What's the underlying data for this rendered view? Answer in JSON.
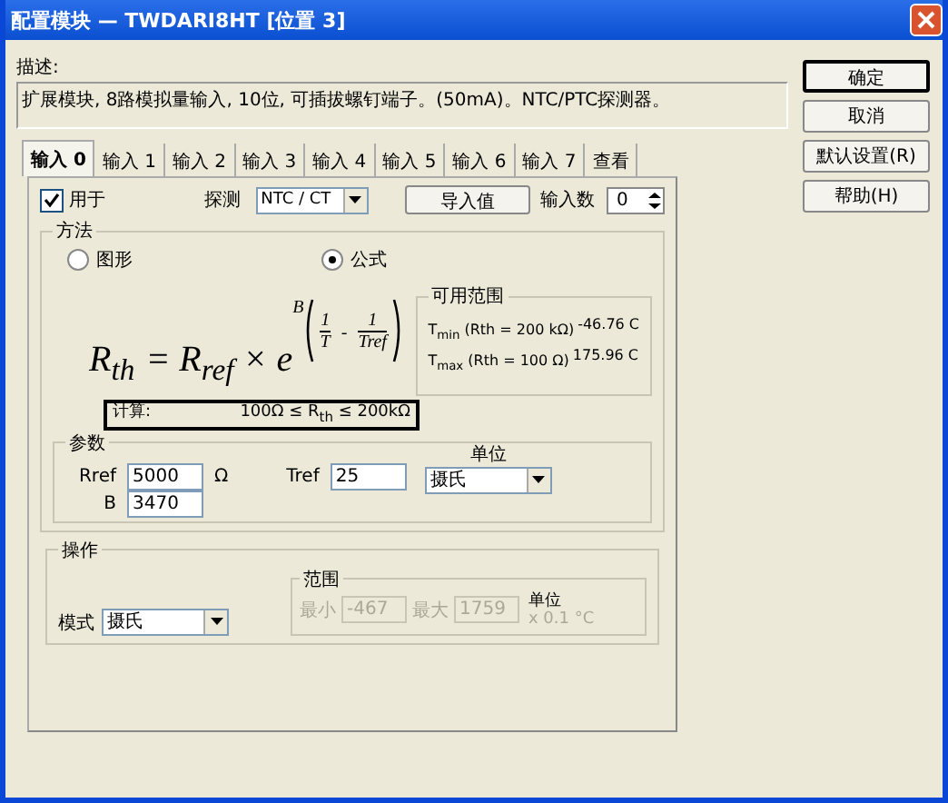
{
  "window": {
    "title": "配置模块 — TWDARI8HT [位置 3]"
  },
  "description": {
    "label": "描述:",
    "text": "扩展模块, 8路模拟量输入, 10位, 可插拔螺钉端子。(50mA)。NTC/PTC探测器。"
  },
  "buttons": [
    {
      "label": "确定",
      "default": true
    },
    {
      "label": "取消",
      "default": false
    },
    {
      "label": "默认设置(R)",
      "default": false
    },
    {
      "label": "帮助(H)",
      "default": false
    }
  ],
  "tabs": [
    {
      "label": "输入 0",
      "selected": true
    },
    {
      "label": "输入 1",
      "selected": false
    },
    {
      "label": "输入 2",
      "selected": false
    },
    {
      "label": "输入 3",
      "selected": false
    },
    {
      "label": "输入 4",
      "selected": false
    },
    {
      "label": "输入 5",
      "selected": false
    },
    {
      "label": "输入 6",
      "selected": false
    },
    {
      "label": "输入 7",
      "selected": false
    },
    {
      "label": "查看",
      "selected": false
    }
  ],
  "used": {
    "label": "用于",
    "checked": true
  },
  "probe": {
    "label": "探测",
    "value": "NTC / CT"
  },
  "import_button": "导入值",
  "input_count": {
    "label": "输入数",
    "value": "0"
  },
  "method": {
    "title": "方法",
    "options": [
      {
        "label": "图形",
        "selected": false
      },
      {
        "label": "公式",
        "selected": true
      }
    ]
  },
  "formula": {
    "lhs": "R$_{th}$",
    "rhs": "= R$_{ref}$ × e",
    "coef": "B",
    "num1": "1",
    "den1": "T",
    "op": "-",
    "num2": "1",
    "den2": "Tref"
  },
  "range_info": {
    "title": "可用范围",
    "rows": [
      {
        "label": "T$_{min}$ (Rth = 200 kΩ)",
        "value": "-46.76 C"
      },
      {
        "label": "T$_{max}$ (Rth = 100 Ω)",
        "value": "175.96 C"
      }
    ]
  },
  "calc": {
    "label": "计算:",
    "text": "100Ω ≤ R$_{th}$ ≤ 200kΩ"
  },
  "params": {
    "title": "参数",
    "rref": {
      "label": "Rref",
      "value": "5000",
      "unit": "Ω"
    },
    "b": {
      "label": "B",
      "value": "3470"
    },
    "tref": {
      "label": "Tref",
      "value": "25"
    },
    "unit": {
      "label": "单位",
      "value": "摄氏"
    }
  },
  "operation": {
    "title": "操作",
    "mode": {
      "label": "模式",
      "value": "摄氏"
    },
    "range": {
      "title": "范围",
      "disabled": true,
      "min": {
        "label": "最小",
        "value": "-467"
      },
      "max": {
        "label": "最大",
        "value": "1759"
      },
      "unit_label": "单位",
      "unit_value": "x 0.1 °C"
    }
  }
}
